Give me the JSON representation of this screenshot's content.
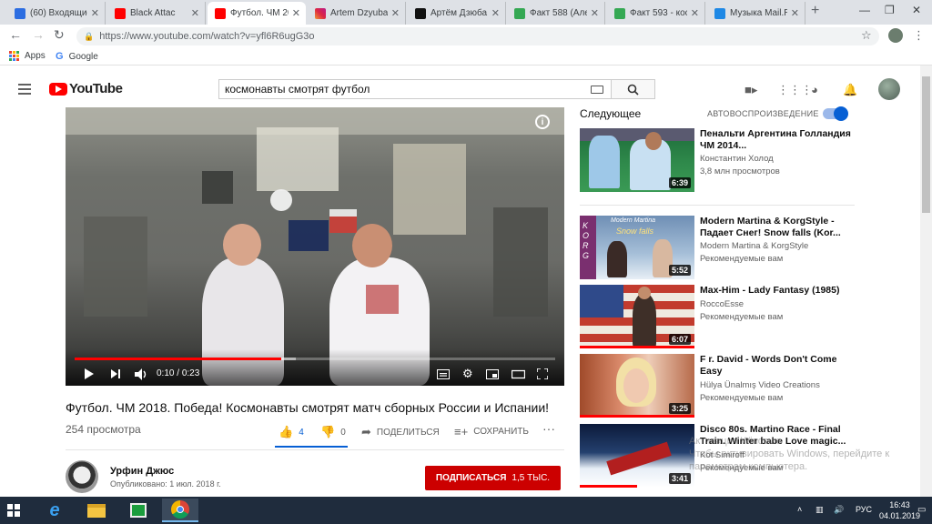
{
  "browser": {
    "tabs": [
      {
        "label": "(60) Входящие",
        "favicon": "mail-icon",
        "color": "#2c6de1"
      },
      {
        "label": "Black Attac",
        "favicon": "youtube-icon",
        "color": "#ff0000"
      },
      {
        "label": "Футбол. ЧМ 20",
        "favicon": "youtube-icon",
        "color": "#ff0000",
        "active": true
      },
      {
        "label": "Artem Dzyuba",
        "favicon": "instagram-icon",
        "color": "#dc2743"
      },
      {
        "label": "Артём Дзюба",
        "favicon": "l-icon",
        "color": "#111111"
      },
      {
        "label": "Факт 588 (Алек",
        "favicon": "green-doc-icon",
        "color": "#34a853"
      },
      {
        "label": "Факт 593 - кос",
        "favicon": "green-doc-icon",
        "color": "#34a853"
      },
      {
        "label": "Музыка Mail.R",
        "favicon": "music-icon",
        "color": "#1e88e5"
      }
    ],
    "url": "https://www.youtube.com/watch?v=yfl6R6ugG3o",
    "bookmarks": [
      {
        "label": "Apps",
        "icon": "apps-grid-icon"
      },
      {
        "label": "Google",
        "icon": "google-icon"
      }
    ]
  },
  "youtube": {
    "logo_text": "YouTube",
    "search_value": "космонавты смотрят футбол"
  },
  "player": {
    "time_current": "0:10",
    "time_total": "0:23",
    "progress_fraction": 0.43,
    "buffered_fraction": 0.46
  },
  "video": {
    "title": "Футбол. ЧМ 2018. Победа! Космонавты смотрят матч сборных России и Испании!",
    "views": "254 просмотра",
    "likes": "4",
    "dislikes": "0",
    "share_label": "ПОДЕЛИТЬСЯ",
    "save_label": "СОХРАНИТЬ",
    "like_fraction": 1.0
  },
  "channel": {
    "name": "Урфин Джюс",
    "published": "Опубликовано: 1 июл. 2018 г.",
    "subscribe_label": "ПОДПИСАТЬСЯ",
    "subscriber_count": "1,5 ТЫС."
  },
  "sidebar": {
    "up_next_label": "Следующее",
    "autoplay_label": "АВТОВОСПРОИЗВЕДЕНИЕ",
    "autoplay_on": true,
    "items": [
      {
        "title": "Пенальти Аргентина Голландия ЧМ 2014...",
        "channel": "Константин Холод",
        "meta": "3,8 млн просмотров",
        "duration": "6:39",
        "watched_fraction": 0
      },
      {
        "title": "Modern Martina & KorgStyle - Падает Снег! Snow falls (Kor...",
        "channel": "Modern Martina & KorgStyle",
        "meta": "Рекомендуемые вам",
        "duration": "5:52",
        "watched_fraction": 0,
        "thumb_text_1": "Modern Martina",
        "thumb_text_2": "Snow falls",
        "thumb_text_3": "KORG"
      },
      {
        "title": "Max-Him - Lady Fantasy (1985)",
        "channel": "RoccoEsse",
        "meta": "Рекомендуемые вам",
        "duration": "6:07",
        "watched_fraction": 1.0
      },
      {
        "title": "F r. David - Words Don't Come Easy",
        "channel": "Hülya Ünalmış Video Creations",
        "meta": "Рекомендуемые вам",
        "duration": "3:25",
        "watched_fraction": 1.0
      },
      {
        "title": "Disco 80s. Martino Race - Final Train. Winter babe Love magic...",
        "channel": "Kot Simiroff",
        "meta": "Рекомендуемые вам",
        "duration": "3:41",
        "watched_fraction": 0.5
      }
    ]
  },
  "watermark": {
    "line1": "Активация Windows",
    "line2": "Чтобы активировать Windows, перейдите к",
    "line3": "параметрам компьютера."
  },
  "taskbar": {
    "language": "РУС",
    "time": "16:43",
    "date": "04.01.2019"
  },
  "colors": {
    "youtube_red": "#ff0000",
    "subscribe_red": "#cc0000",
    "link_blue": "#065fd4",
    "taskbar": "#1f2c3d"
  }
}
